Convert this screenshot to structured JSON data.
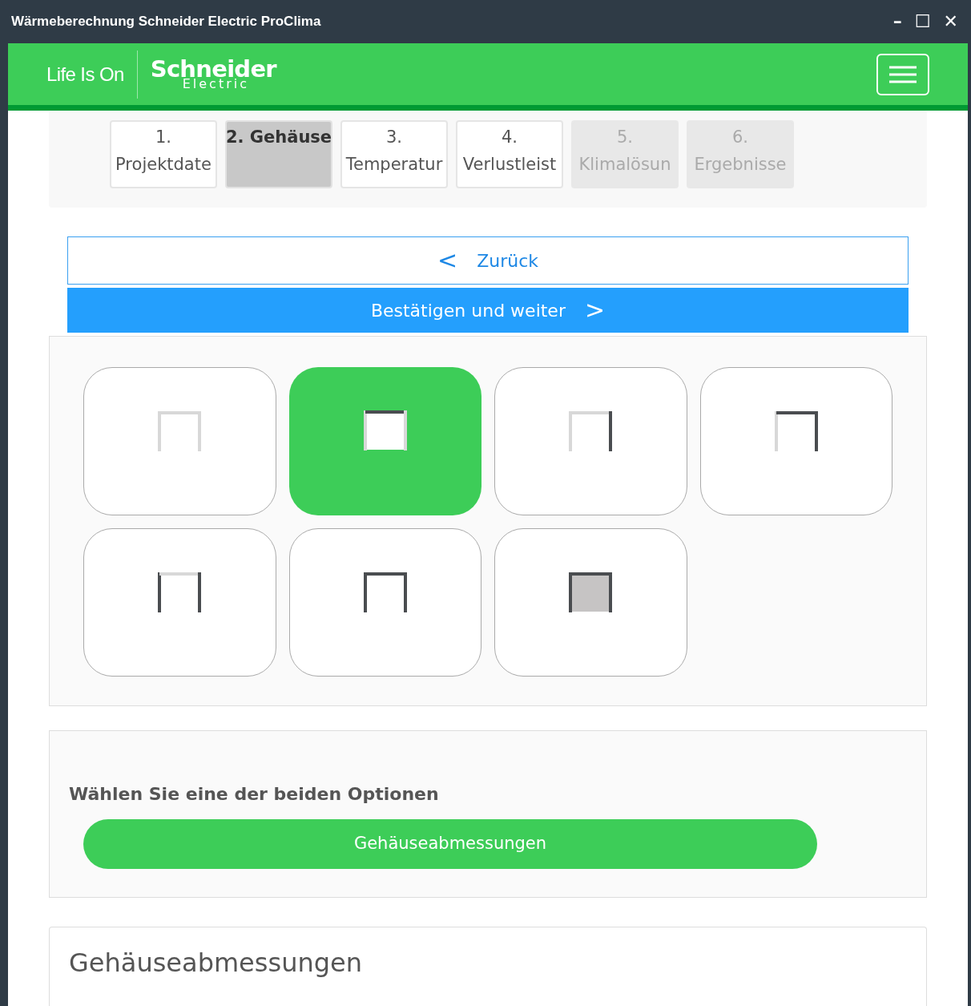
{
  "window": {
    "title": "Wärmeberechnung Schneider Electric ProClima",
    "controls": [
      "–",
      "☐",
      "✕"
    ]
  },
  "header": {
    "tagline": "Life Is On",
    "brand": "Schneider",
    "brand_sub": "Electric"
  },
  "steps": [
    {
      "number": "1.",
      "label": "Projektdate",
      "selected": false,
      "disabled": false
    },
    {
      "number": "2.",
      "label": "Gehäuse",
      "selected": true,
      "disabled": false
    },
    {
      "number": "3.",
      "label": "Temperatur",
      "selected": false,
      "disabled": false
    },
    {
      "number": "4.",
      "label": "Verlustleist",
      "selected": false,
      "disabled": false
    },
    {
      "number": "5.",
      "label": "Klimalösun",
      "selected": false,
      "disabled": true
    },
    {
      "number": "6.",
      "label": "Ergebnisse",
      "selected": false,
      "disabled": true
    }
  ],
  "nav": {
    "back": "Zurück",
    "back_icon": "<",
    "next": "Bestätigen und weiter",
    "next_icon": ">"
  },
  "enclosures": [
    {
      "kind": "open",
      "selected": false
    },
    {
      "kind": "closed",
      "selected": true
    },
    {
      "kind": "right",
      "selected": false
    },
    {
      "kind": "top-right",
      "selected": false
    },
    {
      "kind": "sides",
      "selected": false
    },
    {
      "kind": "full",
      "selected": false
    },
    {
      "kind": "filled",
      "selected": false
    }
  ],
  "options": {
    "prompt": "Wählen Sie eine der beiden Optionen",
    "button": "Gehäuseabmessungen"
  },
  "section": {
    "title": "Gehäuseabmessungen"
  }
}
